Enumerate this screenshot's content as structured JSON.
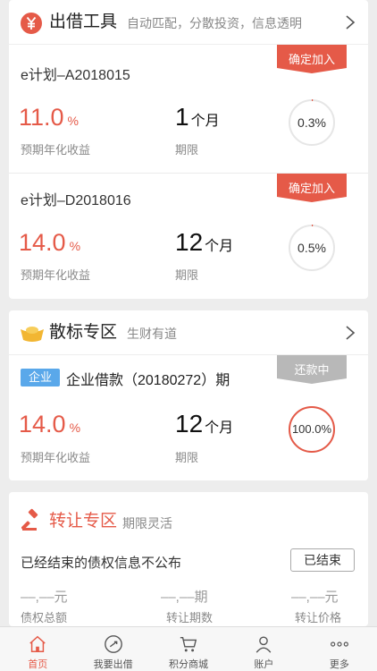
{
  "colors": {
    "accent": "#e55a48",
    "gray_ribbon": "#b8b8b8",
    "tag_blue": "#5aa8ea"
  },
  "lend_tools": {
    "title": "出借工具",
    "subtitle": "自动匹配，分散投资，信息透明",
    "icon": "yen-coin-icon",
    "plans": [
      {
        "name": "e计划–A2018015",
        "rate": "11.0",
        "rate_unit": "%",
        "rate_label": "预期年化收益",
        "term": "1",
        "term_unit": "个月",
        "term_label": "期限",
        "progress_text": "0.3%",
        "progress": 0.003,
        "ribbon": "确定加入"
      },
      {
        "name": "e计划–D2018016",
        "rate": "14.0",
        "rate_unit": "%",
        "rate_label": "预期年化收益",
        "term": "12",
        "term_unit": "个月",
        "term_label": "期限",
        "progress_text": "0.5%",
        "progress": 0.005,
        "ribbon": "确定加入"
      }
    ]
  },
  "scatter": {
    "title": "散标专区",
    "subtitle": "生财有道",
    "icon": "gold-ingot-icon",
    "loan": {
      "tag": "企业",
      "title": "企业借款（20180272）期",
      "rate": "14.0",
      "rate_unit": "%",
      "rate_label": "预期年化收益",
      "term": "12",
      "term_unit": "个月",
      "term_label": "期限",
      "progress_text": "100.0%",
      "progress": 1.0,
      "ribbon": "还款中"
    }
  },
  "transfer": {
    "title": "转让专区",
    "subtitle": "期限灵活",
    "icon": "gavel-icon",
    "notice": "已经结束的债权信息不公布",
    "button": "已结束",
    "stats": [
      {
        "value": "––,––元",
        "label": "债权总额"
      },
      {
        "value": "––,––期",
        "label": "转让期数"
      },
      {
        "value": "––,––元",
        "label": "转让价格"
      }
    ]
  },
  "tabbar": [
    {
      "label": "首页",
      "icon": "home-icon",
      "active": true
    },
    {
      "label": "我要出借",
      "icon": "invest-icon",
      "active": false
    },
    {
      "label": "积分商城",
      "icon": "cart-icon",
      "active": false
    },
    {
      "label": "账户",
      "icon": "user-icon",
      "active": false
    },
    {
      "label": "更多",
      "icon": "more-icon",
      "active": false
    }
  ]
}
